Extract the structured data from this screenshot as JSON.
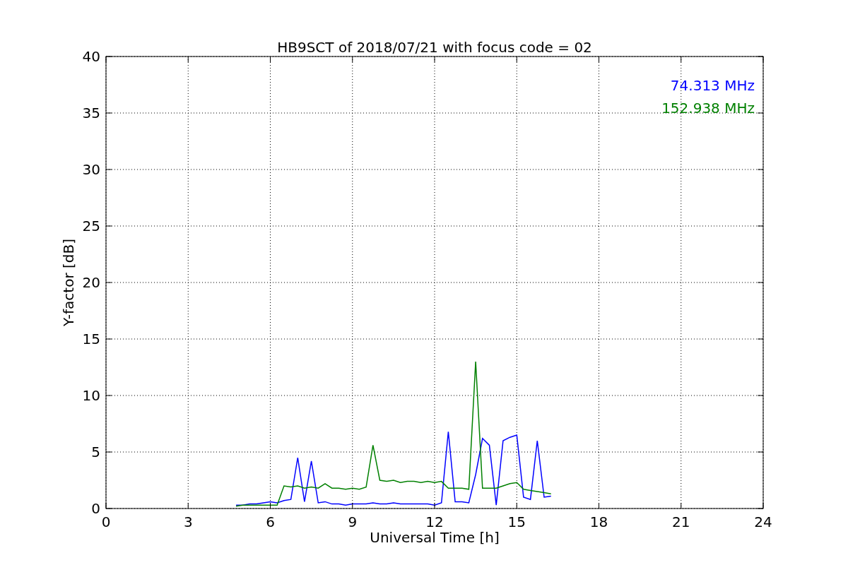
{
  "chart_data": {
    "type": "line",
    "title": "HB9SCT of 2018/07/21 with focus code = 02",
    "xlabel": "Universal Time [h]",
    "ylabel": "Y-factor [dB]",
    "x": [
      4.75,
      5,
      5.25,
      5.5,
      5.75,
      6,
      6.25,
      6.5,
      6.75,
      7,
      7.25,
      7.5,
      7.75,
      8,
      8.25,
      8.5,
      8.75,
      9,
      9.25,
      9.5,
      9.75,
      10,
      10.25,
      10.5,
      10.75,
      11,
      11.25,
      11.5,
      11.75,
      12,
      12.25,
      12.5,
      12.75,
      13,
      13.25,
      13.5,
      13.75,
      14,
      14.25,
      14.5,
      14.75,
      15,
      15.25,
      15.5,
      15.75,
      16,
      16.25
    ],
    "series": [
      {
        "name": "74.313 MHz",
        "color": "#0000ff",
        "values": [
          0.3,
          0.3,
          0.4,
          0.4,
          0.5,
          0.6,
          0.5,
          0.7,
          0.8,
          4.5,
          0.6,
          4.2,
          0.5,
          0.6,
          0.4,
          0.4,
          0.3,
          0.4,
          0.4,
          0.4,
          0.5,
          0.4,
          0.4,
          0.5,
          0.4,
          0.4,
          0.4,
          0.4,
          0.4,
          0.3,
          0.5,
          6.8,
          0.6,
          0.6,
          0.5,
          3.0,
          6.2,
          5.6,
          0.3,
          6.0,
          6.3,
          6.5,
          1.0,
          0.8,
          6.0,
          1.0,
          1.1
        ]
      },
      {
        "name": "152.938 MHz",
        "color": "#008000",
        "values": [
          0.2,
          0.3,
          0.3,
          0.3,
          0.3,
          0.3,
          0.3,
          2.0,
          1.9,
          2.0,
          1.8,
          1.9,
          1.8,
          2.2,
          1.8,
          1.8,
          1.7,
          1.8,
          1.7,
          1.9,
          5.6,
          2.5,
          2.4,
          2.5,
          2.3,
          2.4,
          2.4,
          2.3,
          2.4,
          2.3,
          2.4,
          1.8,
          1.8,
          1.8,
          1.7,
          13.0,
          1.8,
          1.8,
          1.8,
          2.0,
          2.2,
          2.3,
          1.7,
          1.6,
          1.5,
          1.4,
          1.3
        ]
      }
    ],
    "grid": true,
    "xlim": [
      0,
      24
    ],
    "ylim": [
      0,
      40
    ],
    "xticks": [
      0,
      3,
      6,
      9,
      12,
      15,
      18,
      21,
      24
    ],
    "yticks": [
      0,
      5,
      10,
      15,
      20,
      25,
      30,
      35,
      40
    ]
  }
}
